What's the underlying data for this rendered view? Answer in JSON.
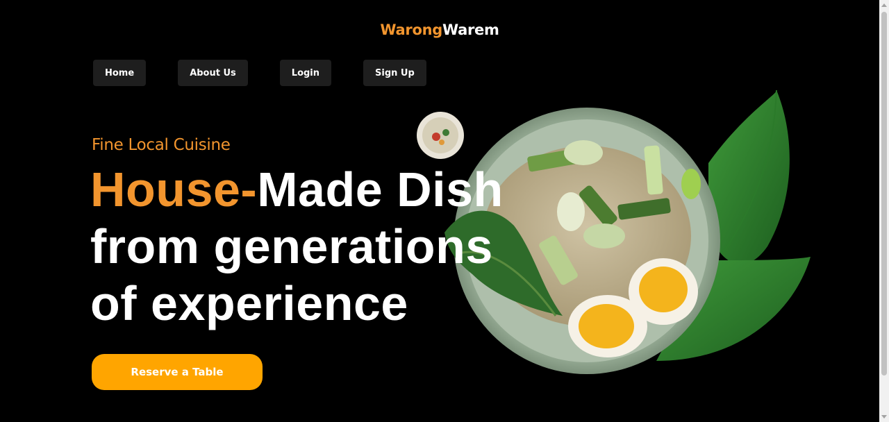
{
  "brand": {
    "part1": "Warong",
    "part2": "Warem"
  },
  "nav": {
    "home": "Home",
    "about": "About Us",
    "login": "Login",
    "signup": "Sign Up"
  },
  "hero": {
    "subtitle": "Fine Local Cuisine",
    "headline_highlight": "House-",
    "headline_line1_rest": "Made Dish",
    "headline_line2": "from generations",
    "headline_line3": "of experience",
    "cta": "Reserve a Table"
  },
  "colors": {
    "accent": "#f2952e",
    "cta": "#ffa500",
    "nav_bg": "#1e1e1e",
    "background": "#000000"
  },
  "icons": [
    "food-plate-image",
    "small-dish-thumbnail"
  ]
}
